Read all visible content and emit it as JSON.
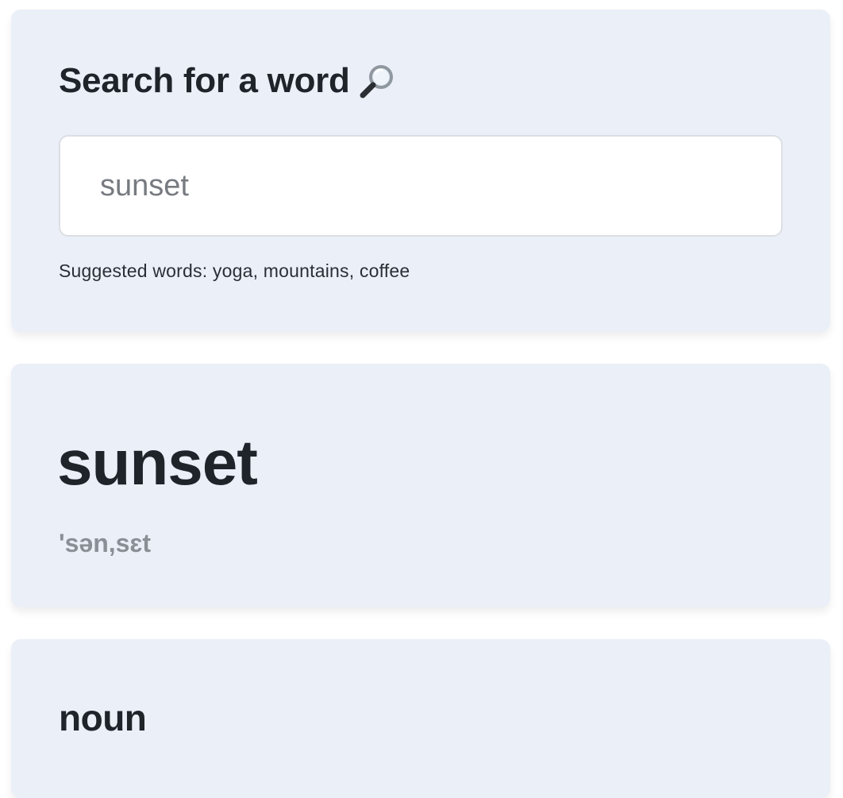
{
  "search": {
    "title": "Search for a word",
    "icon": "magnifying-glass-icon",
    "input_placeholder": "sunset",
    "input_value": "",
    "suggestions_label": "Suggested words:",
    "suggestions": [
      "yoga",
      "mountains",
      "coffee"
    ]
  },
  "result": {
    "word": "sunset",
    "phonetic": "'sən,sɛt"
  },
  "meaning": {
    "part_of_speech": "noun"
  },
  "colors": {
    "card_background": "#ebeff8",
    "text": "#1f242b",
    "phonetic": "#8a8f96",
    "input_border": "#dcdfe4"
  }
}
